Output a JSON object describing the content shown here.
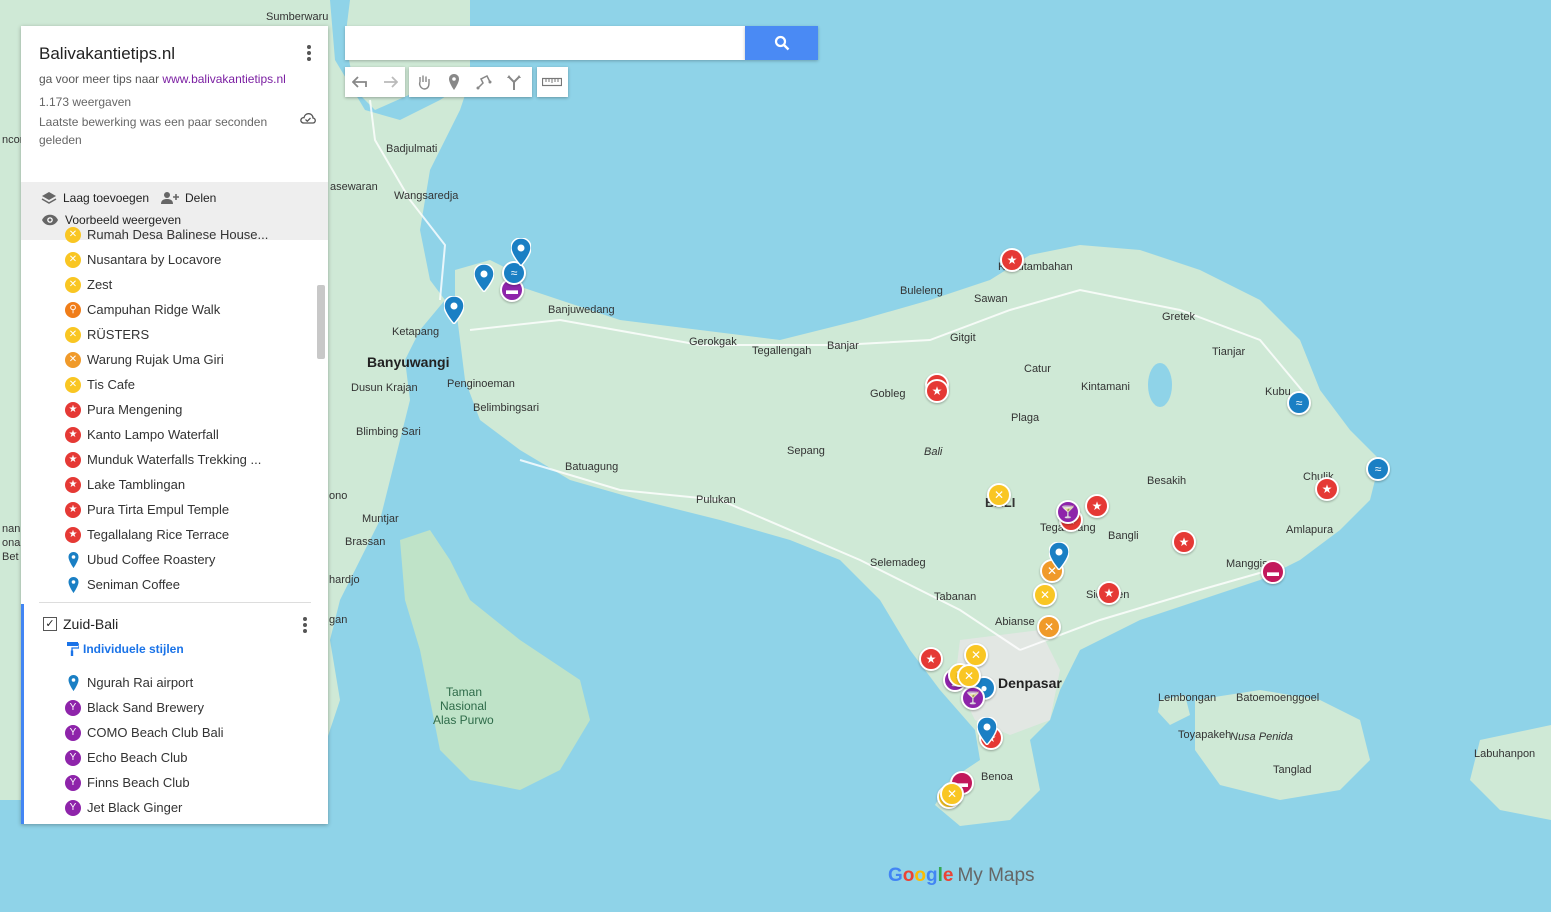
{
  "header": {
    "title": "Balivakantietips.nl",
    "subtitle_prefix": "ga voor meer tips naar",
    "subtitle_link": "www.balivakantietips.nl",
    "views": "1.173 weergaven",
    "last_edit": "Laatste bewerking was een paar seconden geleden"
  },
  "actions": {
    "add_layer": "Laag toevoegen",
    "share": "Delen",
    "preview": "Voorbeeld weergeven"
  },
  "layer1_items": [
    {
      "label": "Rumah Desa Balinese House...",
      "icon": "restaurant-icon",
      "color": "#f9c623"
    },
    {
      "label": "Nusantara by Locavore",
      "icon": "restaurant-icon",
      "color": "#f9c623"
    },
    {
      "label": "Zest",
      "icon": "restaurant-icon",
      "color": "#f9c623"
    },
    {
      "label": "Campuhan Ridge Walk",
      "icon": "hiking-icon",
      "color": "#f07d19"
    },
    {
      "label": "RÜSTERS",
      "icon": "restaurant-icon",
      "color": "#f9c623"
    },
    {
      "label": "Warung Rujak Uma Giri",
      "icon": "restaurant-icon",
      "color": "#f09a2a"
    },
    {
      "label": "Tis Cafe",
      "icon": "restaurant-icon",
      "color": "#f9c623"
    },
    {
      "label": "Pura Mengening",
      "icon": "star-icon",
      "color": "#e53935"
    },
    {
      "label": "Kanto Lampo Waterfall",
      "icon": "star-icon",
      "color": "#e53935"
    },
    {
      "label": "Munduk Waterfalls Trekking ...",
      "icon": "star-icon",
      "color": "#e53935"
    },
    {
      "label": "Lake Tamblingan",
      "icon": "star-icon",
      "color": "#e53935"
    },
    {
      "label": "Pura Tirta Empul Temple",
      "icon": "star-icon",
      "color": "#e53935"
    },
    {
      "label": "Tegallalang Rice Terrace",
      "icon": "star-icon",
      "color": "#e53935"
    },
    {
      "label": "Ubud Coffee Roastery",
      "icon": "location-pin-icon",
      "color": "#1a7fc4"
    },
    {
      "label": "Seniman Coffee",
      "icon": "location-pin-icon",
      "color": "#1a7fc4"
    }
  ],
  "layer2": {
    "name": "Zuid-Bali",
    "checked": "✓",
    "styles_label": "Individuele stijlen",
    "items": [
      {
        "label": "Ngurah Rai airport",
        "icon": "location-pin-icon",
        "color": "#1a7fc4"
      },
      {
        "label": "Black Sand Brewery",
        "icon": "cocktail-icon",
        "color": "#8e24aa"
      },
      {
        "label": "COMO Beach Club Bali",
        "icon": "cocktail-icon",
        "color": "#8e24aa"
      },
      {
        "label": "Echo Beach Club",
        "icon": "cocktail-icon",
        "color": "#8e24aa"
      },
      {
        "label": "Finns Beach Club",
        "icon": "cocktail-icon",
        "color": "#8e24aa"
      },
      {
        "label": "Jet Black Ginger",
        "icon": "cocktail-icon",
        "color": "#8e24aa"
      }
    ]
  },
  "search": {
    "placeholder": ""
  },
  "toolbar": [
    "undo-icon",
    "redo-icon",
    "hand-icon",
    "add-marker-icon",
    "draw-line-icon",
    "directions-icon",
    "ruler-icon"
  ],
  "map_labels": {
    "sumberwaru": "Sumberwaru",
    "badjulmati": "Badjulmati",
    "asewaran": "asewaran",
    "wangsaredja": "Wangsaredja",
    "ketapang": "Ketapang",
    "banyuwangi": "Banyuwangi",
    "dusun_krajan": "Dusun Krajan",
    "blimbing_sari": "Blimbing Sari",
    "penginoeman": "Penginoeman",
    "belimbingsari": "Belimbingsari",
    "banjuwedang": "Banjuwedang",
    "gerokgak": "Gerokgak",
    "tegallengah": "Tegallengah",
    "banjar": "Banjar",
    "buleleng": "Buleleng",
    "sawan": "Sawan",
    "kubutambahan": "Kubutambahan",
    "gretek": "Gretek",
    "tianjar": "Tianjar",
    "gitgit": "Gitgit",
    "catur": "Catur",
    "kintamani": "Kintamani",
    "gobleg": "Gobleg",
    "plaga": "Plaga",
    "bali_italic": "Bali",
    "sepang": "Sepang",
    "batuagung": "Batuagung",
    "pulukan": "Pulukan",
    "besakih": "Besakih",
    "bali_caps": "BALI",
    "bangli": "Bangli",
    "amlapura": "Amlapura",
    "manggis": "Manggis",
    "chulik": "Chulik",
    "kubu": "Kubu",
    "tegallalang": "Tegallalang",
    "selemadeg": "Selemadeg",
    "tabanan": "Tabanan",
    "abianse": "Abianse",
    "sidemen": "Sidemen",
    "denpasar": "Denpasar",
    "benoa": "Benoa",
    "lembongan": "Lembongan",
    "batoemoenggoel": "Batoemoenggoel",
    "nusa_penida": "Nusa Penida",
    "toyapakeh": "Toyapakeh",
    "tanglad": "Tanglad",
    "labuhanpon": "Labuhanpon",
    "muntjar": "Muntjar",
    "brassan": "Brassan",
    "taman1": "Taman",
    "taman2": "Nasional",
    "taman3": "Alas Purwo",
    "ono": "ono",
    "hardjo": "hardjo",
    "gan": "gan",
    "ncor": "ncor",
    "nan": "nan",
    "ona": "ona",
    "bet": "Bet"
  },
  "logo": {
    "google": "Google",
    "mymaps": "My Maps"
  },
  "colors": {
    "sea": "#8fd3e8",
    "land": "#cfe9d6",
    "accent": "#4285f4"
  }
}
